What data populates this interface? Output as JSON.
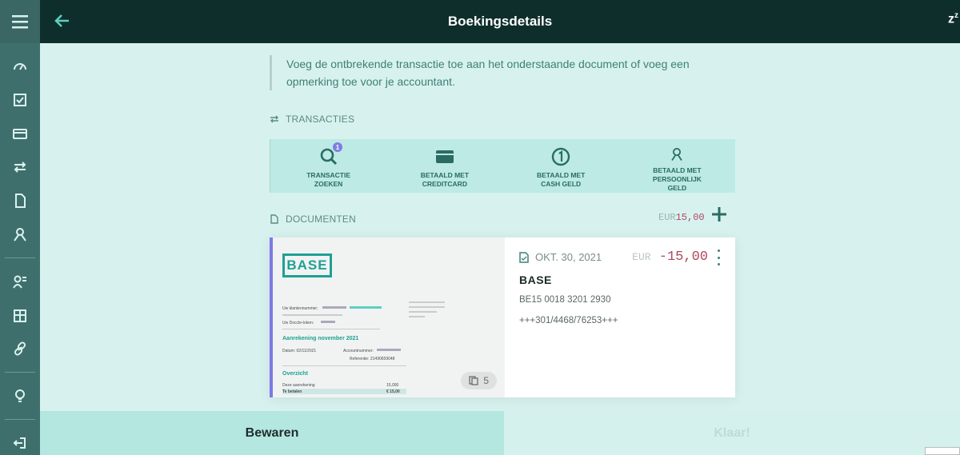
{
  "header": {
    "title": "Boekingsdetails",
    "right_icon": "zz"
  },
  "sidebar": {
    "icons": [
      "menu-icon",
      "gauge-icon",
      "checkbox-icon",
      "card-icon",
      "transfer-icon",
      "document-icon",
      "people-icon",
      "user-list-icon",
      "building-icon",
      "link-icon",
      "bulb-icon",
      "logout-icon"
    ]
  },
  "notice": "Voeg de ontbrekende transactie toe aan het onderstaande document of voeg een opmerking toe voor je accountant.",
  "transactions": {
    "label": "TRANSACTIES",
    "options": [
      {
        "label": "TRANSACTIE\nZOEKEN",
        "badge": "1",
        "icon": "search-icon"
      },
      {
        "label": "BETAALD MET\nCREDITCARD",
        "icon": "creditcard-icon"
      },
      {
        "label": "BETAALD MET\nCASH GELD",
        "icon": "coin-icon"
      },
      {
        "label": "BETAALD MET\nPERSOONLIJK\nGELD",
        "icon": "person-icon"
      }
    ]
  },
  "documents": {
    "label": "DOCUMENTEN",
    "total_currency": "EUR",
    "total_amount": "15,00"
  },
  "doc_card": {
    "logo": "BASE",
    "pages": "5",
    "date": "OKT. 30, 2021",
    "currency": "EUR",
    "amount": "-15,00",
    "name": "BASE",
    "iban": "BE15 0018 3201 2930",
    "reference": "+++301/4468/76253+++",
    "preview": {
      "customer_no": "Uw klantennummer:",
      "doccle_token": "Uw Doccle-token:",
      "invoice_title": "Aanrekening november 2021",
      "date_label": "Datum: 02/11/2021",
      "account_label": "Accountnummer:",
      "reference_label": "Referentie: 21490659048",
      "overview": "Overzicht",
      "this_invoice": "Deze aanrekening",
      "this_invoice_amount": "15,000",
      "to_pay": "Te betalen",
      "to_pay_amount": "€ 15,00"
    }
  },
  "footer": {
    "save_label": "Bewaren",
    "done_label": "Klaar!"
  },
  "colors": {
    "accent": "#1da193",
    "dark_header": "#0e2e2c",
    "sidebar": "#3f6f6c",
    "amount_red": "#b0485f",
    "purple": "#7d79e6"
  }
}
